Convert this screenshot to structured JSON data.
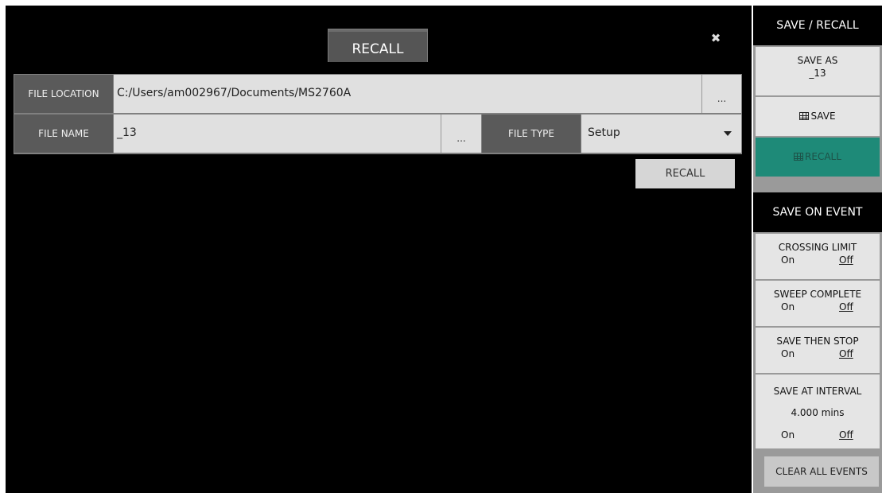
{
  "dialog": {
    "title": "RECALL",
    "close_glyph": "✖",
    "file_location_label": "FILE LOCATION",
    "file_location_value": "C:/Users/am002967/Documents/MS2760A",
    "browse_glyph": "...",
    "file_name_label": "FILE NAME",
    "file_name_value": "_13",
    "file_type_label": "FILE TYPE",
    "file_type_value": "Setup",
    "recall_button": "RECALL"
  },
  "side": {
    "header": "SAVE / RECALL",
    "save_as_label": "SAVE AS",
    "save_as_value": "_13",
    "save_label": "SAVE",
    "recall_label": "RECALL",
    "save_on_event_header": "SAVE ON EVENT",
    "crossing_limit": {
      "label": "CROSSING LIMIT",
      "on": "On",
      "off": "Off"
    },
    "sweep_complete": {
      "label": "SWEEP COMPLETE",
      "on": "On",
      "off": "Off"
    },
    "save_then_stop": {
      "label": "SAVE THEN STOP",
      "on": "On",
      "off": "Off"
    },
    "save_at_interval": {
      "label": "SAVE AT INTERVAL",
      "value": "4.000 mins",
      "on": "On",
      "off": "Off"
    },
    "clear_all_events": "CLEAR ALL EVENTS"
  },
  "colors": {
    "background": "#000000",
    "accent_active": "#1e8a78",
    "panel": "#e5e5e5"
  },
  "icons": {
    "close": "close-icon",
    "grid": "grid-icon",
    "dropdown": "chevron-down-icon"
  }
}
